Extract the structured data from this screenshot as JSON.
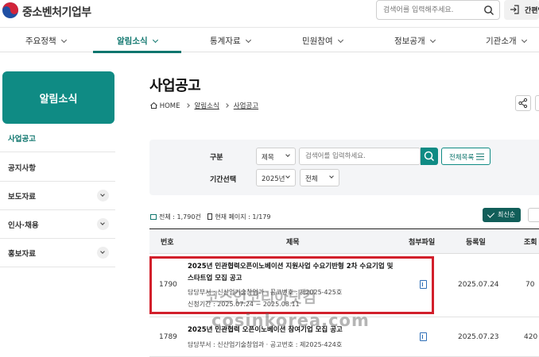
{
  "header": {
    "ministry_name": "중소벤처기업부",
    "search_placeholder": "검색어를 입력해주세요.",
    "simple_label": "간편인"
  },
  "gnb": {
    "items": [
      "주요정책",
      "알림소식",
      "통계자료",
      "민원참여",
      "정보공개",
      "기관소개"
    ],
    "active": "알림소식"
  },
  "sidebar": {
    "title": "알림소식",
    "items": [
      {
        "label": "사업공고",
        "active": true,
        "expandable": false
      },
      {
        "label": "공지사항",
        "active": false,
        "expandable": false
      },
      {
        "label": "보도자료",
        "active": false,
        "expandable": true
      },
      {
        "label": "인사·채용",
        "active": false,
        "expandable": true
      },
      {
        "label": "홍보자료",
        "active": false,
        "expandable": true
      }
    ]
  },
  "page": {
    "title": "사업공고",
    "breadcrumb": [
      "HOME",
      "알림소식",
      "사업공고"
    ]
  },
  "filter": {
    "label_category": "구분",
    "label_period": "기간선택",
    "category_value": "제목",
    "keyword_placeholder": "검색어를 입력하세요.",
    "view_all": "전체목록",
    "year_value": "2025년",
    "month_value": "전체"
  },
  "counts": {
    "total": "전체 : 1,790건",
    "current_page": "현재 페이지 : 1/179",
    "sort_label": "최신순"
  },
  "table": {
    "headers": [
      "번호",
      "제목",
      "첨부파일",
      "등록일",
      "조회"
    ],
    "rows": [
      {
        "no": "1790",
        "title_line1": "2025년 민관협력오픈이노베이션 지원사업 수요기반형 2차 수요기업 및",
        "title_line2": "스타트업 모집 공고",
        "meta1": "담당부서 : 신산업기술창업과 · 공고번호 : 제2025-425호",
        "meta2": "신청기간 : 2025.07.24 ~ 2025.08.11",
        "date": "2025.07.24",
        "views": "70"
      },
      {
        "no": "1789",
        "title_line1": "2025년 민관협력 오픈이노베이션 참여기업 모집 공고",
        "meta1": "담당부서 : 신산업기술창업과 · 공고번호 : 제2025-424호",
        "date": "2025.07.23",
        "views": "420"
      }
    ]
  },
  "watermark": {
    "line1": "코스인코리아닷컴",
    "line2": "cosinkorea.com"
  }
}
